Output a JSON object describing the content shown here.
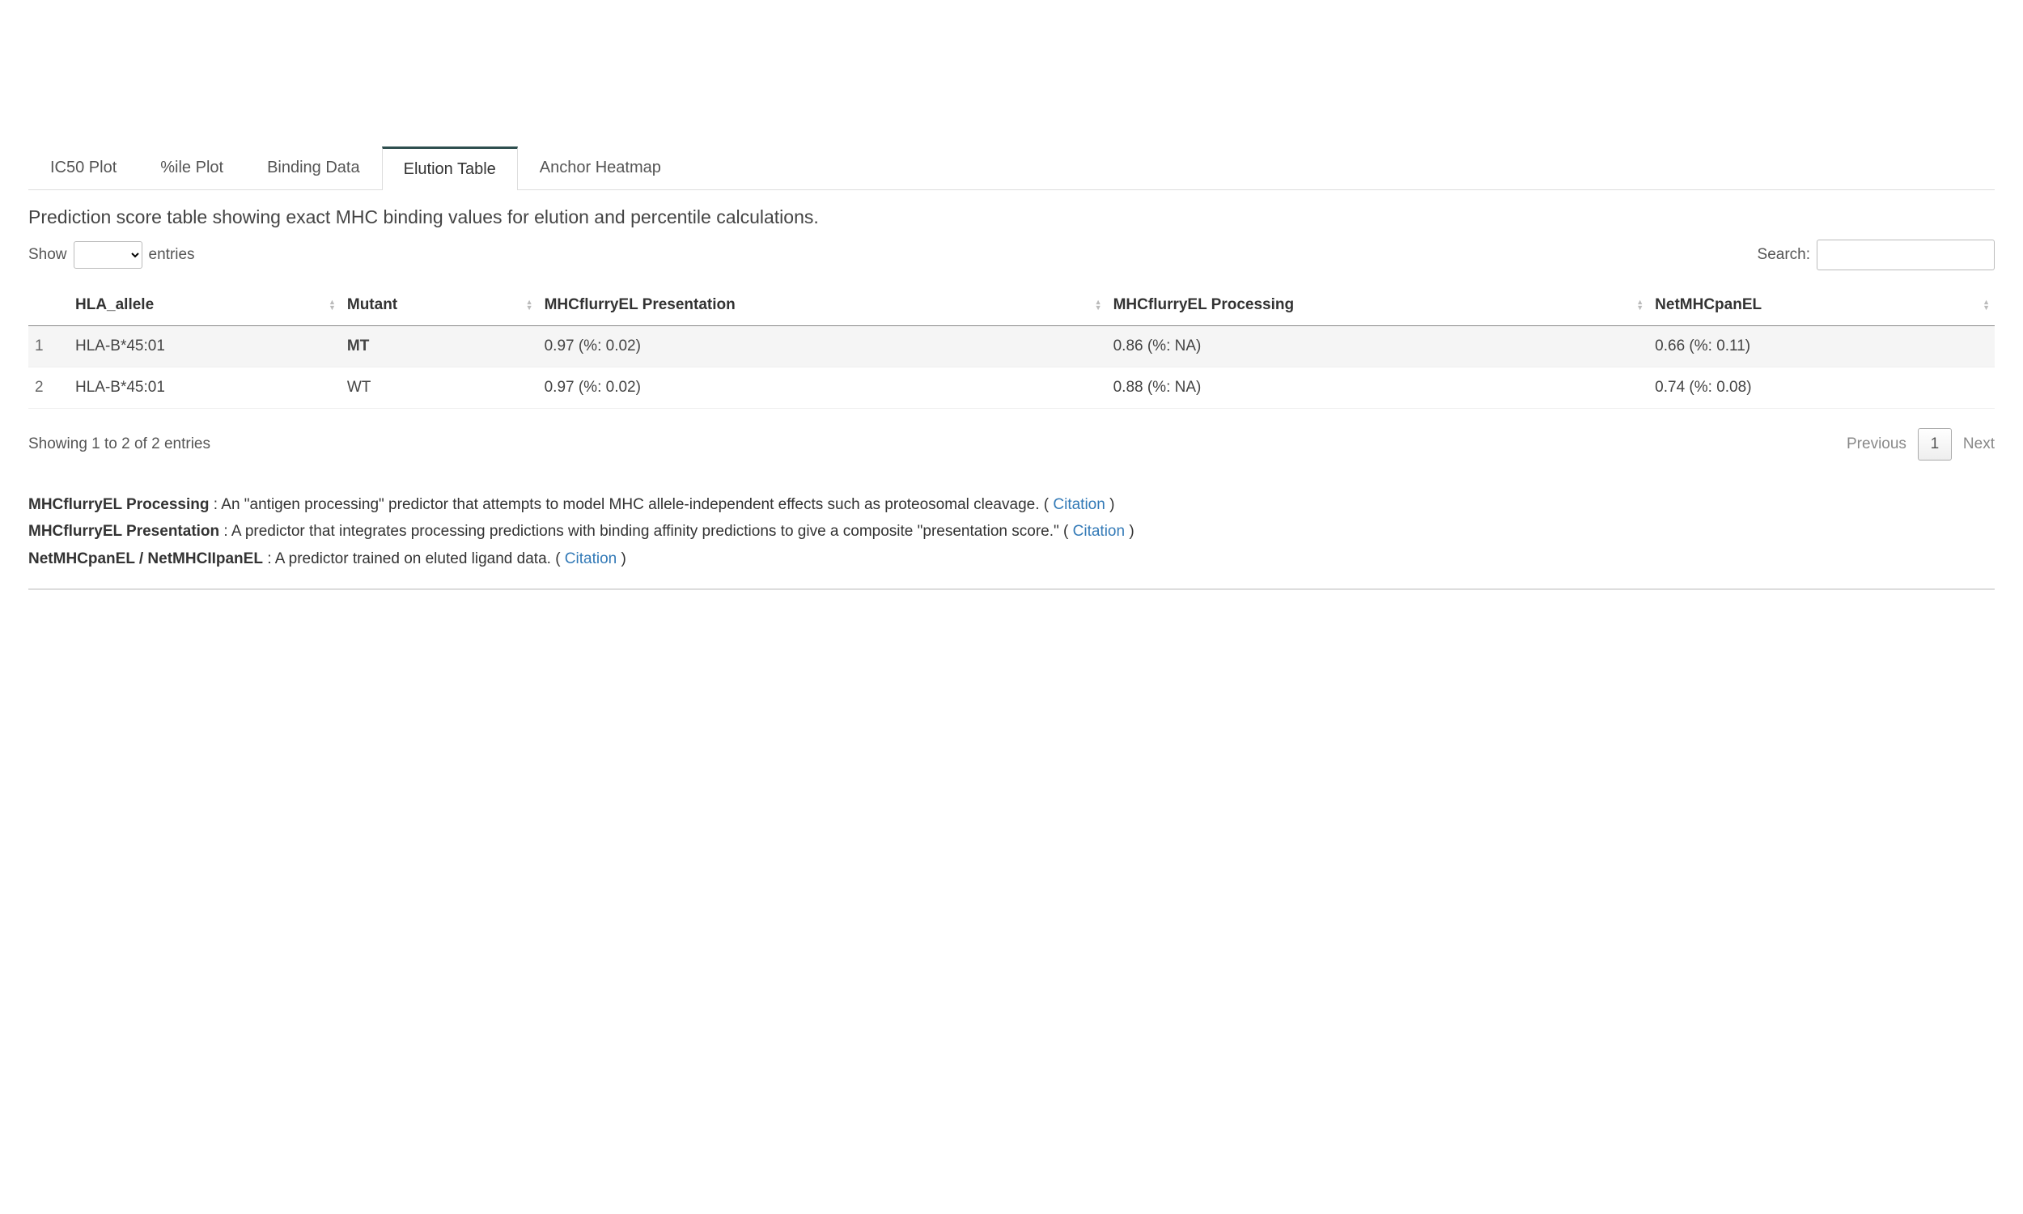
{
  "tabs": {
    "items": [
      {
        "label": "IC50 Plot",
        "active": false
      },
      {
        "label": "%ile Plot",
        "active": false
      },
      {
        "label": "Binding Data",
        "active": false
      },
      {
        "label": "Elution Table",
        "active": true
      },
      {
        "label": "Anchor Heatmap",
        "active": false
      }
    ]
  },
  "description": "Prediction score table showing exact MHC binding values for elution and percentile calculations.",
  "labels": {
    "show": "Show",
    "entries": "entries",
    "search": "Search:",
    "previous": "Previous",
    "next": "Next",
    "citation": "Citation"
  },
  "search": {
    "value": ""
  },
  "columns": [
    "",
    "HLA_allele",
    "Mutant",
    "MHCflurryEL Presentation",
    "MHCflurryEL Processing",
    "NetMHCpanEL"
  ],
  "rows": [
    {
      "idx": "1",
      "allele": "HLA-B*45:01",
      "mutant": "MT",
      "mutant_hl": true,
      "presentation": "0.97 (%: 0.02)",
      "processing": "0.86 (%: NA)",
      "netmhcpanel": "0.66 (%: 0.11)"
    },
    {
      "idx": "2",
      "allele": "HLA-B*45:01",
      "mutant": "WT",
      "mutant_hl": false,
      "presentation": "0.97 (%: 0.02)",
      "processing": "0.88 (%: NA)",
      "netmhcpanel": "0.74 (%: 0.08)"
    }
  ],
  "footer_info": "Showing 1 to 2 of 2 entries",
  "current_page": "1",
  "definitions": [
    {
      "term": "MHCflurryEL Processing",
      "desc": " : An \"antigen processing\" predictor that attempts to model MHC allele-independent effects such as proteosomal cleavage. ( "
    },
    {
      "term": "MHCflurryEL Presentation",
      "desc": " : A predictor that integrates processing predictions with binding affinity predictions to give a composite \"presentation score.\" ( "
    },
    {
      "term": "NetMHCpanEL / NetMHCIIpanEL",
      "desc": " : A predictor trained on eluted ligand data. ( "
    }
  ]
}
